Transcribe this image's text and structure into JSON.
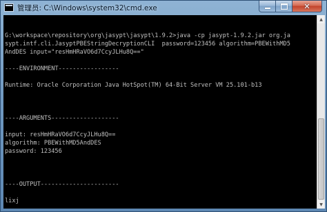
{
  "window": {
    "title": "管理员: C:\\Windows\\system32\\cmd.exe"
  },
  "caption_buttons": {
    "minimize_icon": "minimize-icon",
    "maximize_icon": "maximize-icon",
    "close_label": "✕"
  },
  "console": {
    "lines": [
      "",
      "",
      "G:\\workspace\\repository\\org\\jasypt\\jasypt\\1.9.2>java -cp jasypt-1.9.2.jar org.ja",
      "sypt.intf.cli.JasyptPBEStringDecryptionCLI  password=123456 algorithm=PBEWithMD5",
      "AndDES input=\"resHmHRaVO6d7CcyJLHu8Q==\"",
      "",
      "----ENVIRONMENT-----------------",
      "",
      "Runtime: Oracle Corporation Java HotSpot(TM) 64-Bit Server VM 25.101-b13",
      "",
      "",
      "",
      "----ARGUMENTS-------------------",
      "",
      "input: resHmHRaVO6d7CcyJLHu8Q==",
      "algorithm: PBEWithMD5AndDES",
      "password: 123456",
      "",
      "",
      "",
      "----OUTPUT----------------------",
      "",
      "lixj",
      ""
    ]
  },
  "colors": {
    "console_bg": "#000000",
    "console_text": "#c0c0c0",
    "title_bar": "#6f98c0",
    "close_button": "#c2432a"
  }
}
